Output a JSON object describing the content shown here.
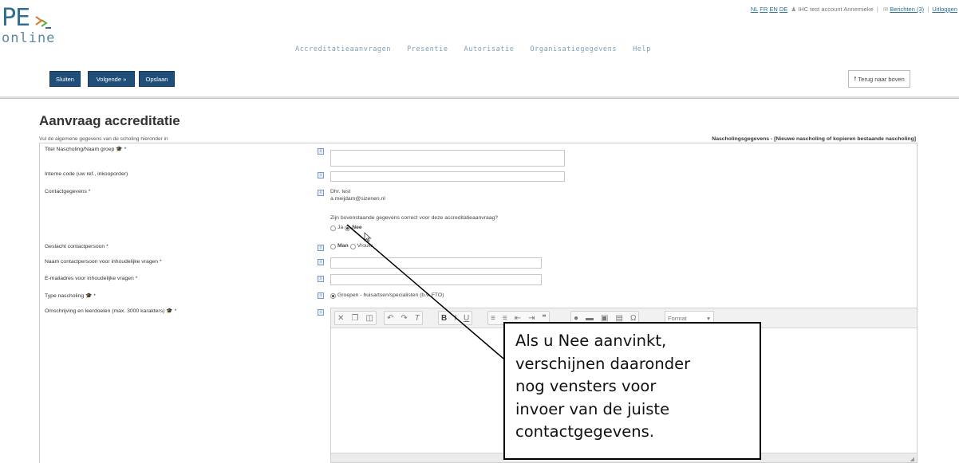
{
  "logo": {
    "pe": "PE",
    "online": "online"
  },
  "toplinks": {
    "lang_nl": "NL",
    "lang_fr": "FR",
    "lang_en": "EN",
    "lang_de": "DE",
    "user": "IHC test account Annemieke",
    "messages": "Berichten (3)",
    "logout": "Uitloggen"
  },
  "nav": [
    "Accreditatieaanvragen",
    "Presentie",
    "Autorisatie",
    "Organisatiegegevens",
    "Help"
  ],
  "toolbar": {
    "close": "Sluiten",
    "next": "Volgende »",
    "save": "Opslaan",
    "back_to_top": "Terug naar boven"
  },
  "page": {
    "title": "Aanvraag accreditatie",
    "intro": "Vul de algemene gegevens van de scholing hieronder in",
    "right_link_label": "Nascholingsgegevens - ",
    "right_link_text": "[Nieuwe nascholing of kopieren bestaande nascholing]"
  },
  "form": {
    "title_label": "Titel Nascholing/Naam groep",
    "internal_code_label": "Interne code (uw ref., inkooporder)",
    "contact_label": "Contactgegevens *",
    "contact_name": "Dhr. test",
    "contact_email": "a.meijdam@sizenen.nl",
    "contact_question": "Zijn bovenstaande gegevens correct voor deze accreditatieaanvraag?",
    "yes_label": "Ja",
    "no_label": "Nee",
    "gender_label": "Geslacht contactpersoon *",
    "male_label": "Man",
    "female_label": "Vrouw",
    "content_contact_label": "Naam contactpersoon voor inhoudelijke vragen *",
    "content_email_label": "E-mailadres voor inhoudelijke vragen *",
    "type_label": "Type nascholing",
    "type_option": "Groepen - huisartsen/specialisten (b.v. FTO)",
    "description_label": "Omschrijving en leerdoelen (max. 3000 karakters)",
    "format_label": "Format",
    "required_mark": "*",
    "info_glyph": "i"
  },
  "callout": {
    "lines": [
      "Als u Nee aanvinkt,",
      "verschijnen daaronder",
      "nog vensters voor",
      "invoer van de juiste",
      "contactgegevens."
    ]
  },
  "colors": {
    "brand": "#2f6e8e",
    "button": "#1f4e79"
  }
}
